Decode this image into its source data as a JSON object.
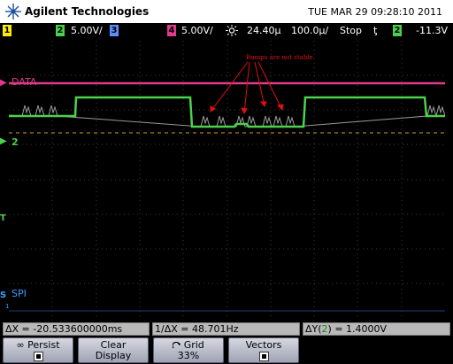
{
  "header": {
    "brand": "Agilent Technologies",
    "datetime": "TUE MAR 29 09:28:10 2011"
  },
  "status": {
    "ch1_num": "1",
    "ch2_num": "2",
    "ch2_scale": "5.00V/",
    "ch3_num": "3",
    "ch4_num": "4",
    "ch4_scale": "5.00V/",
    "trigger_icon": "sun-trigger-icon",
    "time_offset": "24.40µ",
    "time_scale": "100.0µ/",
    "run_state": "Stop",
    "trigger_slope": "ƫ",
    "trigger_src": "2",
    "trigger_level": "-11.3V"
  },
  "screen": {
    "annotation": "Bumps are not stable",
    "label_data": "DATA",
    "label_ch2": "2",
    "label_spi": "SPI",
    "label_t": "T",
    "label_s": "S",
    "label_s_sub": "1"
  },
  "measurements": {
    "delta_x": "ΔX = -20.533600000ms",
    "inv_delta_x": "1/ΔX = 48.701Hz",
    "delta_y_prefix": "ΔY(",
    "delta_y_src": "2",
    "delta_y_suffix": ") = 1.4000V"
  },
  "softkeys": {
    "persist": "Persist",
    "persist_icon": "∞",
    "clear_line1": "Clear",
    "clear_line2": "Display",
    "grid_label": "Grid",
    "grid_value": "33%",
    "vectors": "Vectors"
  },
  "colors": {
    "ch1": "#ffee00",
    "ch2": "#4cd14c",
    "ch3": "#5b8fff",
    "ch4": "#e03a8a",
    "annotation": "#e01010",
    "spi": "#3aa0ff"
  }
}
